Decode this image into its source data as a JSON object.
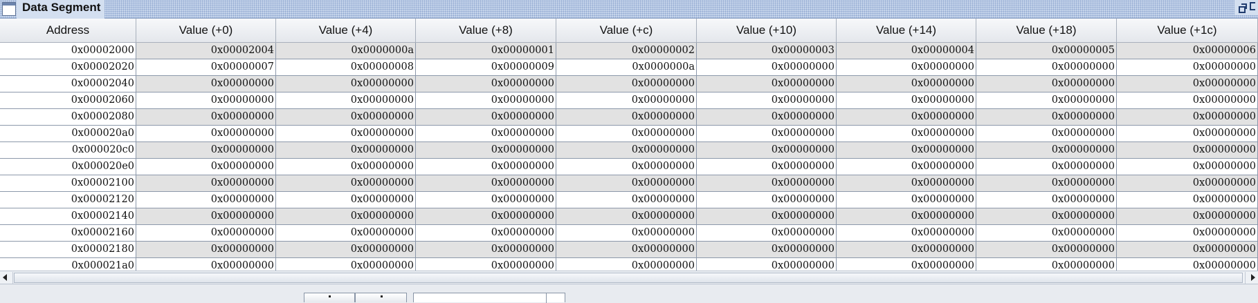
{
  "window": {
    "title": "Data Segment"
  },
  "table": {
    "columns": [
      "Address",
      "Value (+0)",
      "Value (+4)",
      "Value (+8)",
      "Value (+c)",
      "Value (+10)",
      "Value (+14)",
      "Value (+18)",
      "Value (+1c)"
    ],
    "rows": [
      [
        "0x00002000",
        "0x00002004",
        "0x0000000a",
        "0x00000001",
        "0x00000002",
        "0x00000003",
        "0x00000004",
        "0x00000005",
        "0x00000006"
      ],
      [
        "0x00002020",
        "0x00000007",
        "0x00000008",
        "0x00000009",
        "0x0000000a",
        "0x00000000",
        "0x00000000",
        "0x00000000",
        "0x00000000"
      ],
      [
        "0x00002040",
        "0x00000000",
        "0x00000000",
        "0x00000000",
        "0x00000000",
        "0x00000000",
        "0x00000000",
        "0x00000000",
        "0x00000000"
      ],
      [
        "0x00002060",
        "0x00000000",
        "0x00000000",
        "0x00000000",
        "0x00000000",
        "0x00000000",
        "0x00000000",
        "0x00000000",
        "0x00000000"
      ],
      [
        "0x00002080",
        "0x00000000",
        "0x00000000",
        "0x00000000",
        "0x00000000",
        "0x00000000",
        "0x00000000",
        "0x00000000",
        "0x00000000"
      ],
      [
        "0x000020a0",
        "0x00000000",
        "0x00000000",
        "0x00000000",
        "0x00000000",
        "0x00000000",
        "0x00000000",
        "0x00000000",
        "0x00000000"
      ],
      [
        "0x000020c0",
        "0x00000000",
        "0x00000000",
        "0x00000000",
        "0x00000000",
        "0x00000000",
        "0x00000000",
        "0x00000000",
        "0x00000000"
      ],
      [
        "0x000020e0",
        "0x00000000",
        "0x00000000",
        "0x00000000",
        "0x00000000",
        "0x00000000",
        "0x00000000",
        "0x00000000",
        "0x00000000"
      ],
      [
        "0x00002100",
        "0x00000000",
        "0x00000000",
        "0x00000000",
        "0x00000000",
        "0x00000000",
        "0x00000000",
        "0x00000000",
        "0x00000000"
      ],
      [
        "0x00002120",
        "0x00000000",
        "0x00000000",
        "0x00000000",
        "0x00000000",
        "0x00000000",
        "0x00000000",
        "0x00000000",
        "0x00000000"
      ],
      [
        "0x00002140",
        "0x00000000",
        "0x00000000",
        "0x00000000",
        "0x00000000",
        "0x00000000",
        "0x00000000",
        "0x00000000",
        "0x00000000"
      ],
      [
        "0x00002160",
        "0x00000000",
        "0x00000000",
        "0x00000000",
        "0x00000000",
        "0x00000000",
        "0x00000000",
        "0x00000000",
        "0x00000000"
      ],
      [
        "0x00002180",
        "0x00000000",
        "0x00000000",
        "0x00000000",
        "0x00000000",
        "0x00000000",
        "0x00000000",
        "0x00000000",
        "0x00000000"
      ],
      [
        "0x000021a0",
        "0x00000000",
        "0x00000000",
        "0x00000000",
        "0x00000000",
        "0x00000000",
        "0x00000000",
        "0x00000000",
        "0x00000000"
      ]
    ]
  },
  "icons": {
    "window": "window-icon",
    "restore": "restore-icon",
    "maximize": "maximize-icon",
    "scroll_left": "scroll-left-arrow-icon",
    "scroll_right": "scroll-right-arrow-icon"
  }
}
